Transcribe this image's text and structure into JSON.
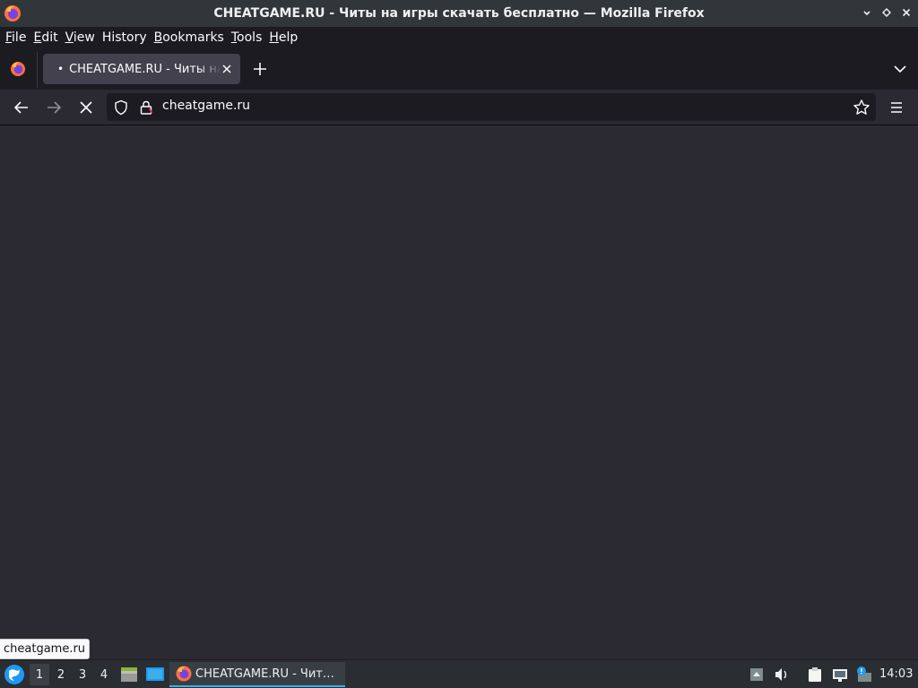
{
  "window": {
    "title": "CHEATGAME.RU - Читы на игры скачать бесплатно — Mozilla Firefox"
  },
  "menubar": {
    "items": [
      {
        "accel": "F",
        "rest": "ile"
      },
      {
        "accel": "E",
        "rest": "dit"
      },
      {
        "accel": "V",
        "rest": "iew"
      },
      {
        "accel": "H",
        "rest": "istory",
        "acc_after": "",
        "pre": ""
      },
      {
        "accel": "B",
        "rest": "ookmarks"
      },
      {
        "accel": "T",
        "rest": "ools"
      },
      {
        "accel": "H",
        "rest": "elp"
      }
    ]
  },
  "tabs": [
    {
      "title": "CHEATGAME.RU - Читы на игры скачать бесплатно",
      "dot": "•",
      "loading": true
    }
  ],
  "navbar": {
    "url": "cheatgame.ru"
  },
  "status": {
    "link": "cheatgame.ru"
  },
  "taskbar": {
    "workspaces": [
      "1",
      "2",
      "3",
      "4"
    ],
    "active_workspace": "1",
    "task_label": "CHEATGAME.RU - Чит…",
    "clock": "14:03"
  },
  "colors": {
    "accent": "#3daee9",
    "content_bg": "#2b2a33",
    "toolbar_bg": "#1c1b22"
  }
}
